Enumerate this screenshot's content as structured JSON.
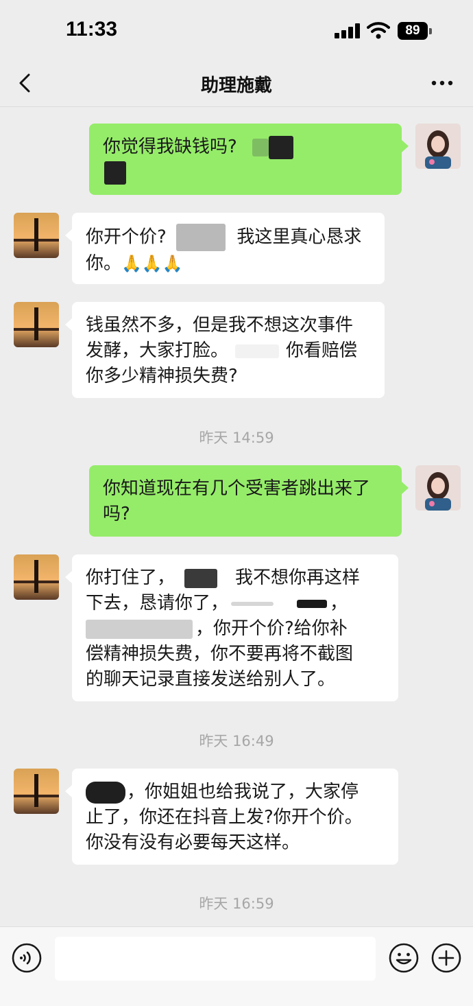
{
  "status_bar": {
    "time": "11:33",
    "battery": "89"
  },
  "nav": {
    "title": "助理施戴"
  },
  "messages": {
    "m1": {
      "t1": "你觉得我缺钱吗?"
    },
    "m2": {
      "t1": "你开个价?",
      "t2": "我这里真心恳求",
      "t3": "你。",
      "emoji": "🙏🙏🙏"
    },
    "m3": {
      "line1": "钱虽然不多，但是我不想这次事件",
      "line2a": "发酵，大家打脸。",
      "line2b": "你看赔偿",
      "line3": "你多少精神损失费?"
    },
    "m4": {
      "line1": "你知道现在有几个受害者跳出来了",
      "line2": "吗?"
    },
    "m5": {
      "line1a": "你打住了，",
      "line1b": "我不想你再这样",
      "line2a": "下去，恳请你了，",
      "line2b": "，",
      "line3b": "，你开个价?给你补",
      "line4": "偿精神损失费，你不要再将不截图",
      "line5": "的聊天记录直接发送给别人了。"
    },
    "m6": {
      "line1b": "，你姐姐也给我说了，大家停",
      "line2": "止了，你还在抖音上发?你开个价。",
      "line3": "你没有没有必要每天这样。"
    }
  },
  "timestamps": {
    "t1": "昨天 14:59",
    "t2": "昨天 16:49",
    "t3": "昨天 16:59"
  },
  "colors": {
    "background": "#ededed",
    "sent_bubble": "#95ec69",
    "received_bubble": "#ffffff",
    "timestamp": "#a6a6a6"
  },
  "icons": {
    "back": "chevron-left-icon",
    "more": "more-dots-icon",
    "voice": "voice-icon",
    "emoji": "emoji-icon",
    "plus": "plus-icon"
  }
}
